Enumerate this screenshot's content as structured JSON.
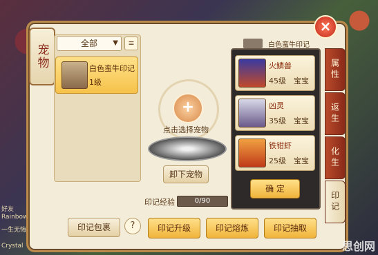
{
  "window": {
    "title": "宠物",
    "close_icon": "×"
  },
  "left_panel": {
    "filter_value": "全部",
    "item": {
      "name": "白色蛮牛印记",
      "level": "1级"
    },
    "bag_button": "印记包裹",
    "help_icon": "?"
  },
  "center": {
    "pick_text": "点击选择宠物",
    "unload_button": "卸下宠物",
    "exp_label": "印记经验",
    "exp_value": "0/90"
  },
  "pet_list": {
    "header_partial": "白色蛮牛印记",
    "pets": [
      {
        "name": "火鳞兽",
        "level": "45级",
        "kind": "宝宝"
      },
      {
        "name": "凶灵",
        "level": "35级",
        "kind": "宝宝"
      },
      {
        "name": "铁钳虾",
        "level": "25级",
        "kind": "宝宝"
      }
    ],
    "confirm_button": "确 定"
  },
  "side_tabs": [
    "属性",
    "返生",
    "化生",
    "印记"
  ],
  "bottom_buttons": [
    "印记升级",
    "印记熔炼",
    "印记抽取"
  ],
  "background_chat": [
    "好友",
    "Rainbow",
    "一生无悔",
    "Crystal"
  ],
  "watermark": "思创网"
}
